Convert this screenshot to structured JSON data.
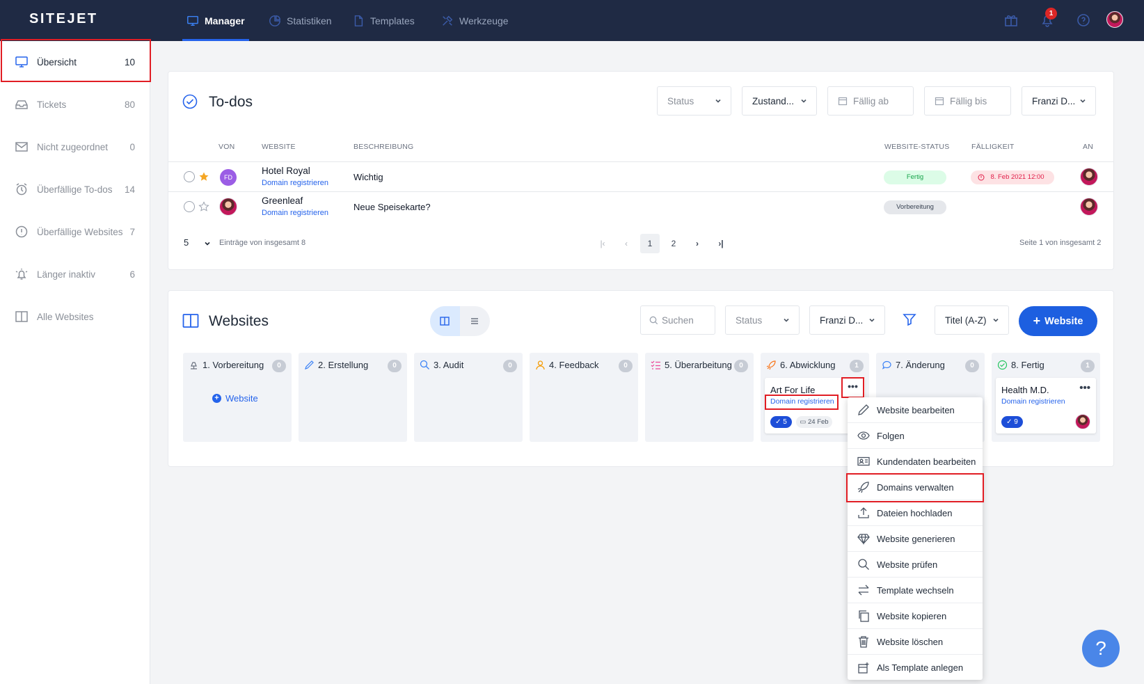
{
  "brand": "SITEJET",
  "topnav": [
    {
      "label": "Manager",
      "icon": "monitor-icon"
    },
    {
      "label": "Statistiken",
      "icon": "pie-chart-icon"
    },
    {
      "label": "Templates",
      "icon": "file-icon"
    },
    {
      "label": "Werkzeuge",
      "icon": "tools-icon"
    }
  ],
  "notifications_count": "1",
  "sidebar": [
    {
      "label": "Übersicht",
      "count": "10"
    },
    {
      "label": "Tickets",
      "count": "80"
    },
    {
      "label": "Nicht zugeordnet",
      "count": "0"
    },
    {
      "label": "Überfällige To-dos",
      "count": "14"
    },
    {
      "label": "Überfällige Websites",
      "count": "7"
    },
    {
      "label": "Länger inaktiv",
      "count": "6"
    },
    {
      "label": "Alle Websites",
      "count": ""
    }
  ],
  "todos": {
    "title": "To-dos",
    "filters": {
      "status": "Status",
      "zustand": "Zustand...",
      "faellig_ab": "Fällig ab",
      "faellig_bis": "Fällig bis",
      "user": "Franzi D..."
    },
    "columns": [
      "VON",
      "WEBSITE",
      "BESCHREIBUNG",
      "WEBSITE-STATUS",
      "FÄLLIGKEIT",
      "AN"
    ],
    "rows": [
      {
        "from": "FD",
        "website": "Hotel Royal",
        "link": "Domain registrieren",
        "description": "Wichtig",
        "status": "Fertig",
        "due": "8. Feb 2021 12:00",
        "starred": true
      },
      {
        "from": "",
        "website": "Greenleaf",
        "link": "Domain registrieren",
        "description": "Neue Speisekarte?",
        "status": "Vorbereitung",
        "due": "",
        "starred": false
      }
    ],
    "per_page": "5",
    "entries_text": "Einträge von insgesamt 8",
    "pages": [
      "1",
      "2"
    ],
    "page_info": "Seite 1 von insgesamt 2"
  },
  "websites": {
    "title": "Websites",
    "search_placeholder": "Suchen",
    "filter_status": "Status",
    "filter_user": "Franzi D...",
    "sort": "Titel (A-Z)",
    "add_button": "Website",
    "columns": [
      {
        "label": "1. Vorbereitung",
        "count": "0"
      },
      {
        "label": "2. Erstellung",
        "count": "0"
      },
      {
        "label": "3. Audit",
        "count": "0"
      },
      {
        "label": "4. Feedback",
        "count": "0"
      },
      {
        "label": "5. Überarbeitung",
        "count": "0"
      },
      {
        "label": "6. Abwicklung",
        "count": "1"
      },
      {
        "label": "7. Änderung",
        "count": "0"
      },
      {
        "label": "8. Fertig",
        "count": "1"
      }
    ],
    "add_website_link": "Website",
    "cards": [
      {
        "title": "Art For Life",
        "link": "Domain registrieren",
        "todos": "5",
        "date": "24 Feb"
      },
      {
        "title": "Health M.D.",
        "link": "Domain registrieren",
        "todos": "9"
      }
    ]
  },
  "context_menu": [
    "Website bearbeiten",
    "Folgen",
    "Kundendaten bearbeiten",
    "Domains verwalten",
    "Dateien hochladen",
    "Website generieren",
    "Website prüfen",
    "Template wechseln",
    "Website kopieren",
    "Website löschen",
    "Als Template anlegen"
  ],
  "help_label": "?"
}
